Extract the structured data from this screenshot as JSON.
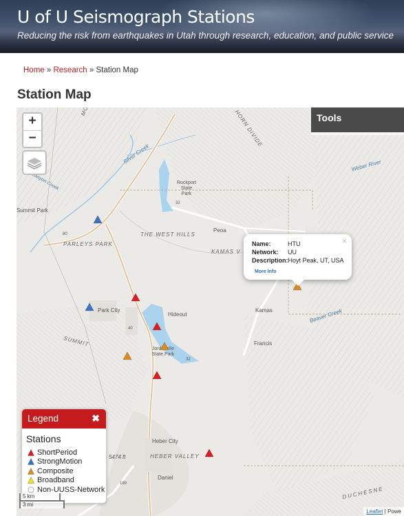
{
  "header": {
    "title": "U of U Seismograph Stations",
    "tagline": "Reducing the risk from earthquakes in Utah through research, education, and public service"
  },
  "breadcrumb": {
    "home": "Home",
    "sep1": " » ",
    "research": "Research",
    "sep2": " » ",
    "current": "Station Map"
  },
  "page_title": "Station Map",
  "map": {
    "zoom_in": "+",
    "zoom_out": "−",
    "tools_label": "Tools",
    "labels": {
      "morgan": "MORGAN",
      "horn_divide": "HORN DIVIDE",
      "silver_creek": "Silver Creek",
      "weber_river": "Weber River",
      "rockport": "Rockport State Park",
      "summit_park": "Summit Park",
      "lost_creek": "East Canyon Creek",
      "parleys_park": "PARLEYS PARK",
      "west_hills": "THE WEST HILLS",
      "peoa": "Peoa",
      "kamas_valley": "KAMAS V",
      "park_city": "Park City",
      "hideout": "Hideout",
      "kamas": "Kamas",
      "beaver_creek": "Beaver Creek",
      "francis": "Francis",
      "summit": "SUMMIT",
      "jordanelle": "Jordanelle State Park",
      "heber_city": "Heber City",
      "heber_valley": "HEBER VALLEY",
      "elev": "5474 ft",
      "daniel": "Daniel",
      "duchesne": "DUCHESNE",
      "route_32a": "32",
      "route_32b": "32",
      "route_80": "80",
      "route_40": "40",
      "route_189": "189"
    },
    "popup": {
      "name_label": "Name:",
      "name_value": "HTU",
      "network_label": "Network:",
      "network_value": "UU",
      "desc_label": "Description:",
      "desc_value": "Hoyt Peak, UT, USA",
      "more_info": "More Info",
      "close": "×"
    },
    "legend": {
      "title": "Legend",
      "close": "✖",
      "section": "Stations",
      "items": [
        {
          "label": "ShortPeriod",
          "color": "#e31a1c",
          "shape": "triangle"
        },
        {
          "label": "StrongMotion",
          "color": "#3a73c4",
          "shape": "triangle"
        },
        {
          "label": "Composite",
          "color": "#e08a1c",
          "shape": "triangle"
        },
        {
          "label": "Broadband",
          "color": "#f2e01a",
          "shape": "triangle"
        },
        {
          "label": "Non-UUSS-Network",
          "color": "#ffffff",
          "shape": "circle"
        }
      ]
    },
    "scale": {
      "km": "5 km",
      "mi": "3 mi"
    },
    "attribution": {
      "leaflet": "Leaflet",
      "sep": " | ",
      "powered": "Powe"
    },
    "stations": [
      {
        "type": "StrongMotion",
        "color": "#3a73c4"
      },
      {
        "type": "StrongMotion",
        "color": "#3a73c4"
      },
      {
        "type": "ShortPeriod",
        "color": "#e31a1c"
      },
      {
        "type": "ShortPeriod",
        "color": "#e31a1c"
      },
      {
        "type": "Composite",
        "color": "#e08a1c"
      },
      {
        "type": "Composite",
        "color": "#e08a1c"
      },
      {
        "type": "ShortPeriod",
        "color": "#e31a1c"
      },
      {
        "type": "ShortPeriod",
        "color": "#e31a1c"
      },
      {
        "type": "Composite",
        "color": "#e08a1c"
      }
    ]
  },
  "colors": {
    "brand_red": "#c41c1c",
    "link_red": "#b41e1e",
    "tools_bg": "#4a4a4a"
  }
}
